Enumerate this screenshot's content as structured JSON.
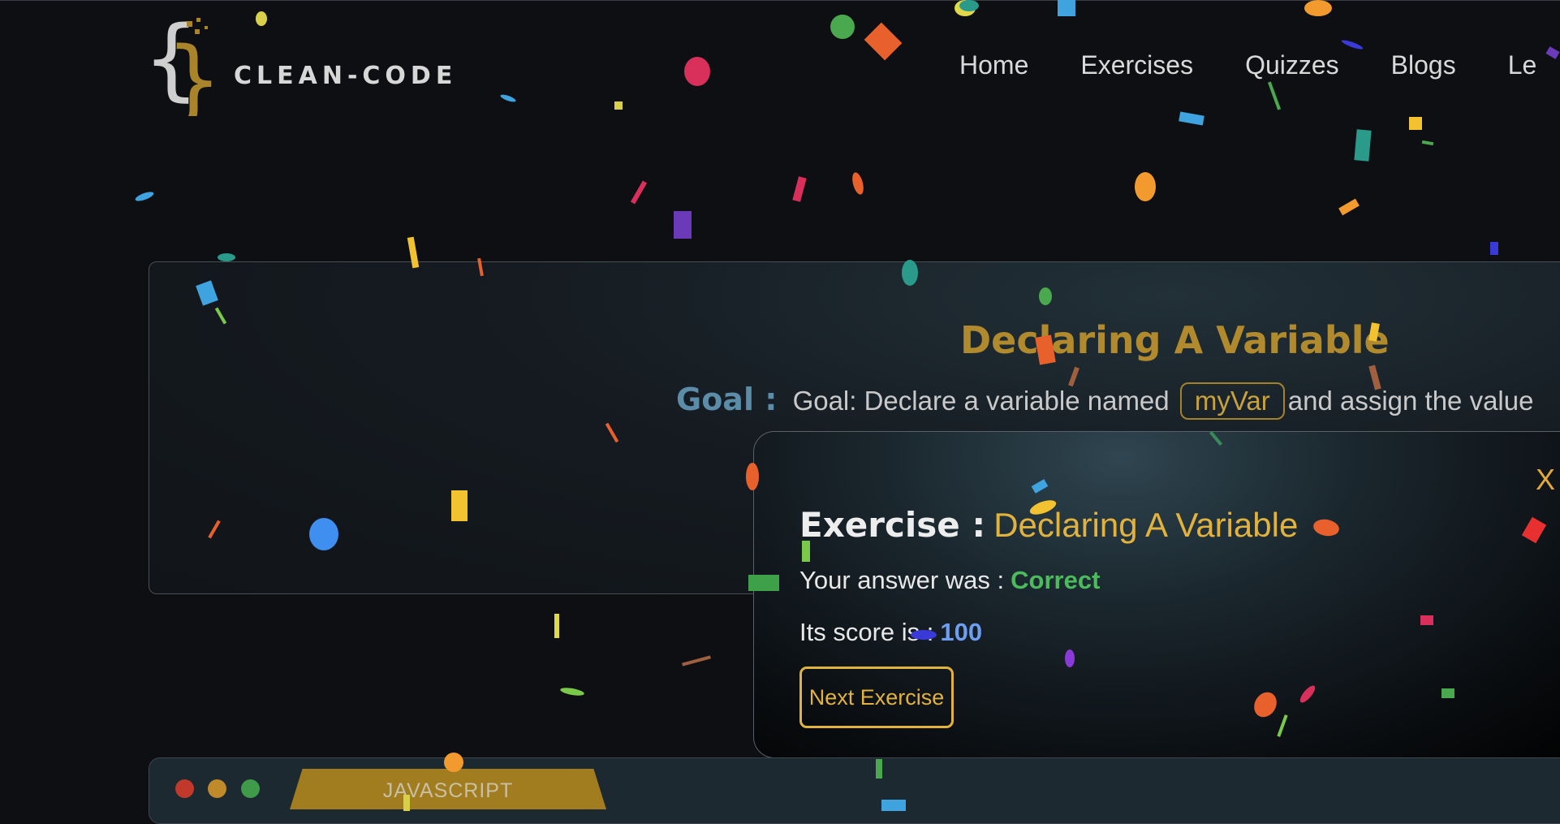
{
  "header": {
    "brand": "CLEAN-CODE",
    "nav": [
      "Home",
      "Exercises",
      "Quizzes",
      "Blogs",
      "Le"
    ]
  },
  "exercise_card": {
    "title": "Declaring A Variable",
    "goal_label": "Goal :",
    "goal_text_before": "Goal: Declare a variable named",
    "goal_code": "myVar",
    "goal_text_after": "and assign the value"
  },
  "modal": {
    "close_label": "X",
    "exercise_label": "Exercise :",
    "exercise_name": "Declaring A Variable",
    "answer_label": "Your answer was :",
    "answer_value": "Correct",
    "score_label": "Its score is :",
    "score_value": "100",
    "next_button": "Next Exercise"
  },
  "editor": {
    "language_tab": "JAVASCRIPT"
  },
  "colors": {
    "accent_gold": "#e2b23f",
    "correct_green": "#4bbb5c",
    "score_blue": "#6f9df0",
    "goal_label_blue": "#5b8ca8",
    "window_red": "#c0392b",
    "window_yellow": "#c08a2a",
    "window_green": "#3f9a4a"
  }
}
